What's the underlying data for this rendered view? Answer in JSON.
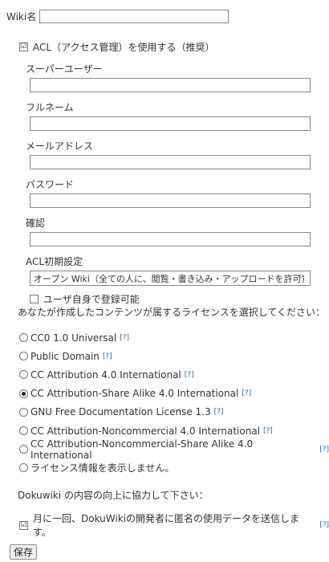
{
  "wiki_name": {
    "label": "Wiki名",
    "value": ""
  },
  "acl": {
    "enable_label": "ACL（アクセス管理）を使用する（推奨）",
    "enable_checked": true,
    "fields": [
      {
        "label": "スーパーユーザー",
        "value": ""
      },
      {
        "label": "フルネーム",
        "value": ""
      },
      {
        "label": "メールアドレス",
        "value": ""
      },
      {
        "label": "パスワード",
        "value": ""
      },
      {
        "label": "確認",
        "value": ""
      }
    ],
    "policy_label": "ACL初期設定",
    "policy_selected": "オープン Wiki（全ての人に、閲覧・書き込み・アップロードを許可）",
    "self_register_label": "ユーザ自身で登録可能",
    "self_register_checked": false
  },
  "license": {
    "intro": "あなたが作成したコンテンツが属するライセンスを選択してください：",
    "help_marker": "[?]",
    "options": [
      {
        "label": "CC0 1.0 Universal",
        "help": true,
        "selected": false
      },
      {
        "label": "Public Domain",
        "help": true,
        "selected": false
      },
      {
        "label": "CC Attribution 4.0 International",
        "help": true,
        "selected": false
      },
      {
        "label": "CC Attribution-Share Alike 4.0 International",
        "help": true,
        "selected": true
      },
      {
        "label": "GNU Free Documentation License 1.3",
        "help": true,
        "selected": false
      },
      {
        "label": "CC Attribution-Noncommercial 4.0 International",
        "help": true,
        "selected": false
      },
      {
        "label": "CC Attribution-Noncommercial-Share Alike 4.0 International",
        "help": true,
        "selected": false
      },
      {
        "label": "ライセンス情報を表示しません。",
        "help": false,
        "selected": false
      }
    ]
  },
  "popularity": {
    "intro": "Dokuwiki の内容の向上に協力して下さい：",
    "checkbox_label": "月に一回、DokuWikiの開発者に匿名の使用データを送信します。",
    "checked": true,
    "help_marker": "[?]"
  },
  "save_label": "保存",
  "colors": {
    "help_link": "#2b6bb5",
    "text": "#333333"
  }
}
